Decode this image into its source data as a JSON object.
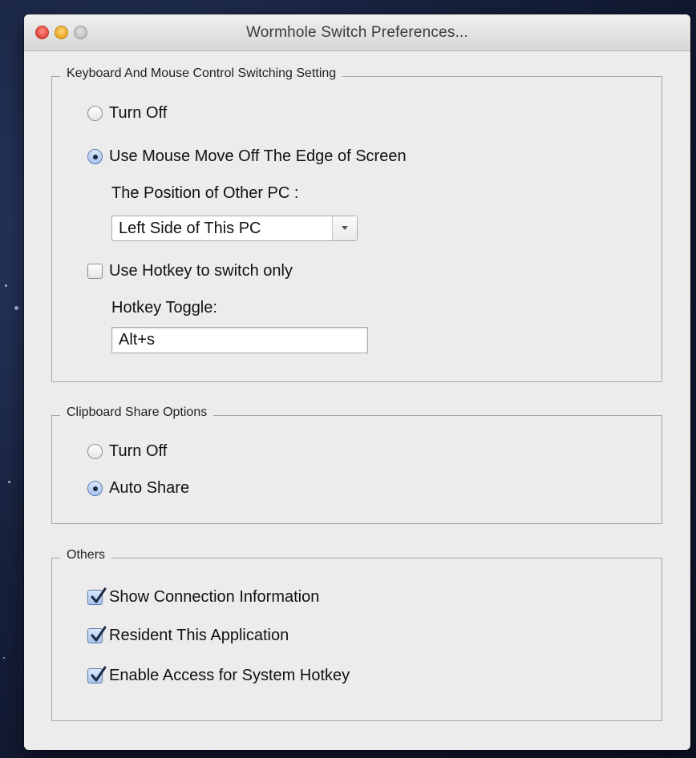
{
  "window": {
    "title": "Wormhole Switch Preferences..."
  },
  "keyboard_mouse": {
    "legend": "Keyboard And Mouse Control Switching Setting",
    "turn_off_label": "Turn Off",
    "use_edge_label": "Use Mouse Move Off The Edge of Screen",
    "selected": "use_edge",
    "position_label": "The Position of Other PC :",
    "position_value": "Left Side of This PC",
    "hotkey_only_label": "Use Hotkey to switch only",
    "hotkey_only_checked": false,
    "hotkey_toggle_label": "Hotkey Toggle:",
    "hotkey_value": "Alt+s"
  },
  "clipboard": {
    "legend": "Clipboard Share Options",
    "turn_off_label": "Turn Off",
    "auto_share_label": "Auto Share",
    "selected": "auto_share"
  },
  "others": {
    "legend": "Others",
    "items": [
      {
        "label": "Show Connection Information",
        "checked": true
      },
      {
        "label": "Resident This Application",
        "checked": true
      },
      {
        "label": "Enable Access for System Hotkey",
        "checked": true
      }
    ]
  },
  "icons": {
    "close": "close-icon",
    "minimize": "minimize-icon",
    "zoom": "zoom-icon",
    "dropdown": "chevron-down-icon",
    "checkmark": "checkmark-icon"
  },
  "colors": {
    "close": "#e0463a",
    "minimize": "#e9a825",
    "zoom": "#bfbfbf",
    "window_bg": "#ececec"
  }
}
